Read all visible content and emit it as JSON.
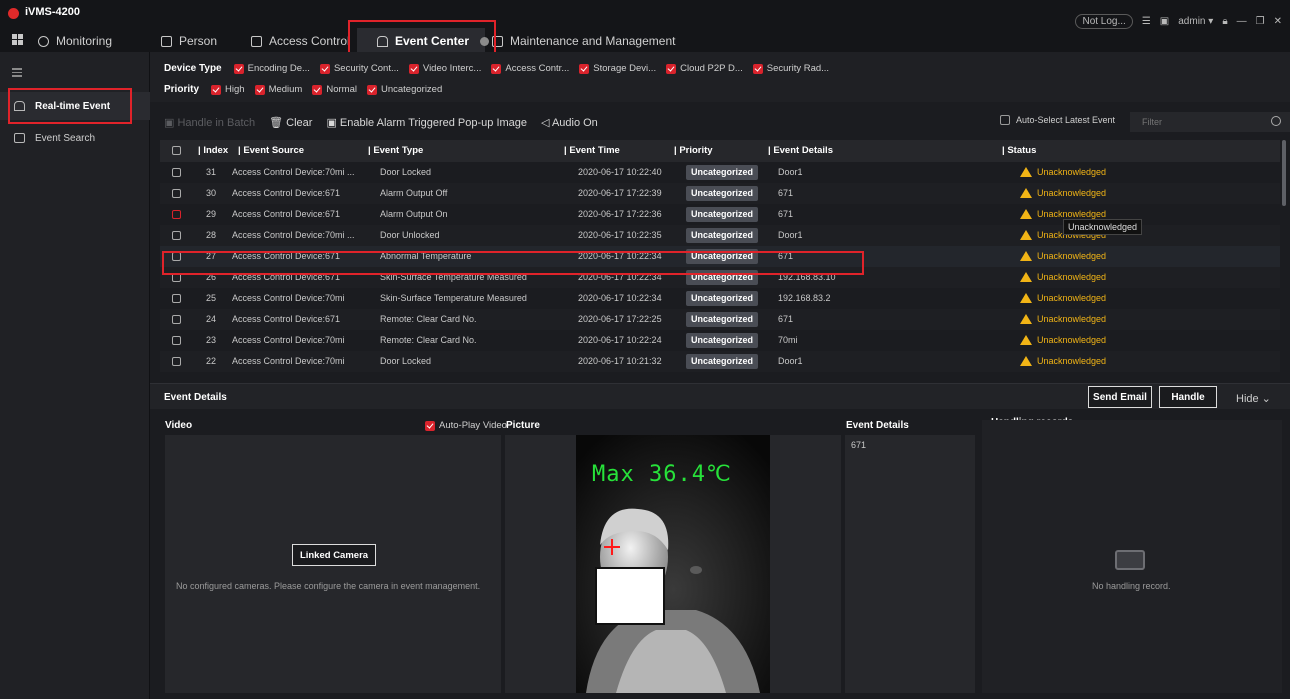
{
  "app": {
    "title": "iVMS-4200"
  },
  "nav_tabs": [
    {
      "label": "Monitoring"
    },
    {
      "label": "Person"
    },
    {
      "label": "Access Control"
    },
    {
      "label": "Event Center"
    },
    {
      "label": "Maintenance and Management"
    }
  ],
  "topright": {
    "not_logged": "Not Log...",
    "user": "admin"
  },
  "sidebar": {
    "items": [
      {
        "label": "Real-time Event"
      },
      {
        "label": "Event Search"
      }
    ]
  },
  "filters": {
    "device_type_label": "Device Type",
    "device_types": [
      "Encoding De...",
      "Security Cont...",
      "Video Interc...",
      "Access Contr...",
      "Storage Devi...",
      "Cloud P2P D...",
      "Security Rad..."
    ],
    "priority_label": "Priority",
    "priorities": [
      "High",
      "Medium",
      "Normal",
      "Uncategorized"
    ]
  },
  "toolbar": {
    "handle_batch": "Handle in Batch",
    "clear": "Clear",
    "enable_popup": "Enable Alarm Triggered Pop-up Image",
    "audio": "Audio On",
    "auto_select": "Auto-Select Latest Event",
    "filter_placeholder": "Filter"
  },
  "table": {
    "headers": [
      "Index",
      "Event Source",
      "Event Type",
      "Event Time",
      "Priority",
      "Event Details",
      "Status"
    ],
    "rows": [
      {
        "index": "31",
        "source": "Access Control Device:70mi ...",
        "type": "Door Locked",
        "time": "2020-06-17 10:22:40",
        "priority": "Uncategorized",
        "details": "Door1",
        "status": "Unacknowledged"
      },
      {
        "index": "30",
        "source": "Access Control Device:671",
        "type": "Alarm Output Off",
        "time": "2020-06-17 17:22:39",
        "priority": "Uncategorized",
        "details": "671",
        "status": "Unacknowledged"
      },
      {
        "index": "29",
        "source": "Access Control Device:671",
        "type": "Alarm Output On",
        "time": "2020-06-17 17:22:36",
        "priority": "Uncategorized",
        "details": "671",
        "status": "Unacknowledged"
      },
      {
        "index": "28",
        "source": "Access Control Device:70mi ...",
        "type": "Door Unlocked",
        "time": "2020-06-17 10:22:35",
        "priority": "Uncategorized",
        "details": "Door1",
        "status": "Unacknowledged"
      },
      {
        "index": "27",
        "source": "Access Control Device:671",
        "type": "Abnormal Temperature",
        "time": "2020-06-17 10:22:34",
        "priority": "Uncategorized",
        "details": "671",
        "status": "Unacknowledged"
      },
      {
        "index": "26",
        "source": "Access Control Device:671",
        "type": "Skin-Surface Temperature Measured",
        "time": "2020-06-17 10:22:34",
        "priority": "Uncategorized",
        "details": "192.168.83.10",
        "status": "Unacknowledged"
      },
      {
        "index": "25",
        "source": "Access Control Device:70mi",
        "type": "Skin-Surface Temperature Measured",
        "time": "2020-06-17 10:22:34",
        "priority": "Uncategorized",
        "details": "192.168.83.2",
        "status": "Unacknowledged"
      },
      {
        "index": "24",
        "source": "Access Control Device:671",
        "type": "Remote: Clear Card No.",
        "time": "2020-06-17 17:22:25",
        "priority": "Uncategorized",
        "details": "671",
        "status": "Unacknowledged"
      },
      {
        "index": "23",
        "source": "Access Control Device:70mi",
        "type": "Remote: Clear Card No.",
        "time": "2020-06-17 10:22:24",
        "priority": "Uncategorized",
        "details": "70mi",
        "status": "Unacknowledged"
      },
      {
        "index": "22",
        "source": "Access Control Device:70mi",
        "type": "Door Locked",
        "time": "2020-06-17 10:21:32",
        "priority": "Uncategorized",
        "details": "Door1",
        "status": "Unacknowledged"
      }
    ],
    "tooltip": "Unacknowledged"
  },
  "details": {
    "title": "Event Details",
    "send_email": "Send Email",
    "handle": "Handle",
    "hide": "Hide",
    "video_label": "Video",
    "autoplay": "Auto-Play Video",
    "picture_label": "Picture",
    "event_details_label": "Event Details",
    "event_details_value": "671",
    "handling_label": "Handling records",
    "linked_camera": "Linked Camera",
    "no_camera_msg": "No configured cameras. Please configure the camera in event management.",
    "no_record_msg": "No handling record.",
    "max_temp": "Max 36.4℃"
  },
  "colors": {
    "accent_red": "#e0232a",
    "warning": "#f1b416",
    "temp_green": "#27e23a"
  }
}
